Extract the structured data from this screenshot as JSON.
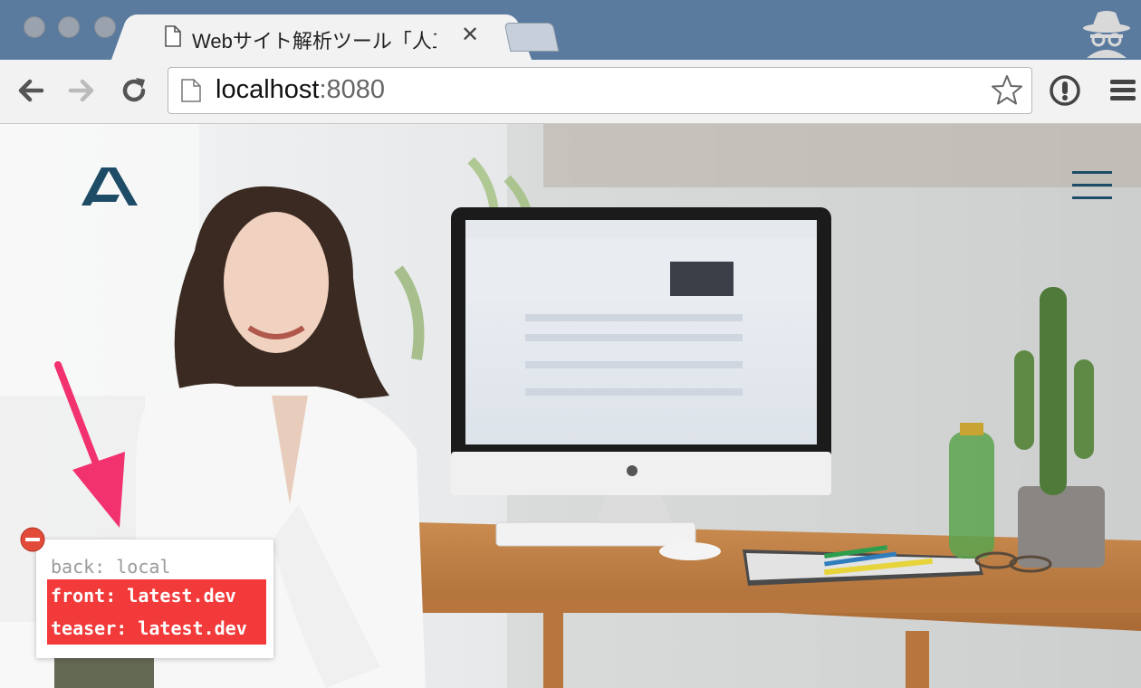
{
  "browser": {
    "tab_title": "Webサイト解析ツール「人工知",
    "url_host": "localhost",
    "url_port": ":8080"
  },
  "dev_panel": {
    "back": "back: local",
    "front": "front: latest.dev",
    "teaser": "teaser: latest.dev"
  },
  "icons": {
    "back": "back-arrow-icon",
    "forward": "forward-arrow-icon",
    "reload": "reload-icon",
    "star": "bookmark-star-icon",
    "incognito": "incognito-icon",
    "extension": "extension-icon",
    "menu": "menu-icon",
    "logo": "ai-analyst-logo",
    "hamburger": "hamburger-menu-icon",
    "close": "close-circle-icon"
  },
  "colors": {
    "titlebar": "#5a7a9e",
    "brand": "#1e4c66",
    "highlight": "#f23a3a",
    "arrow": "#f2316f"
  }
}
